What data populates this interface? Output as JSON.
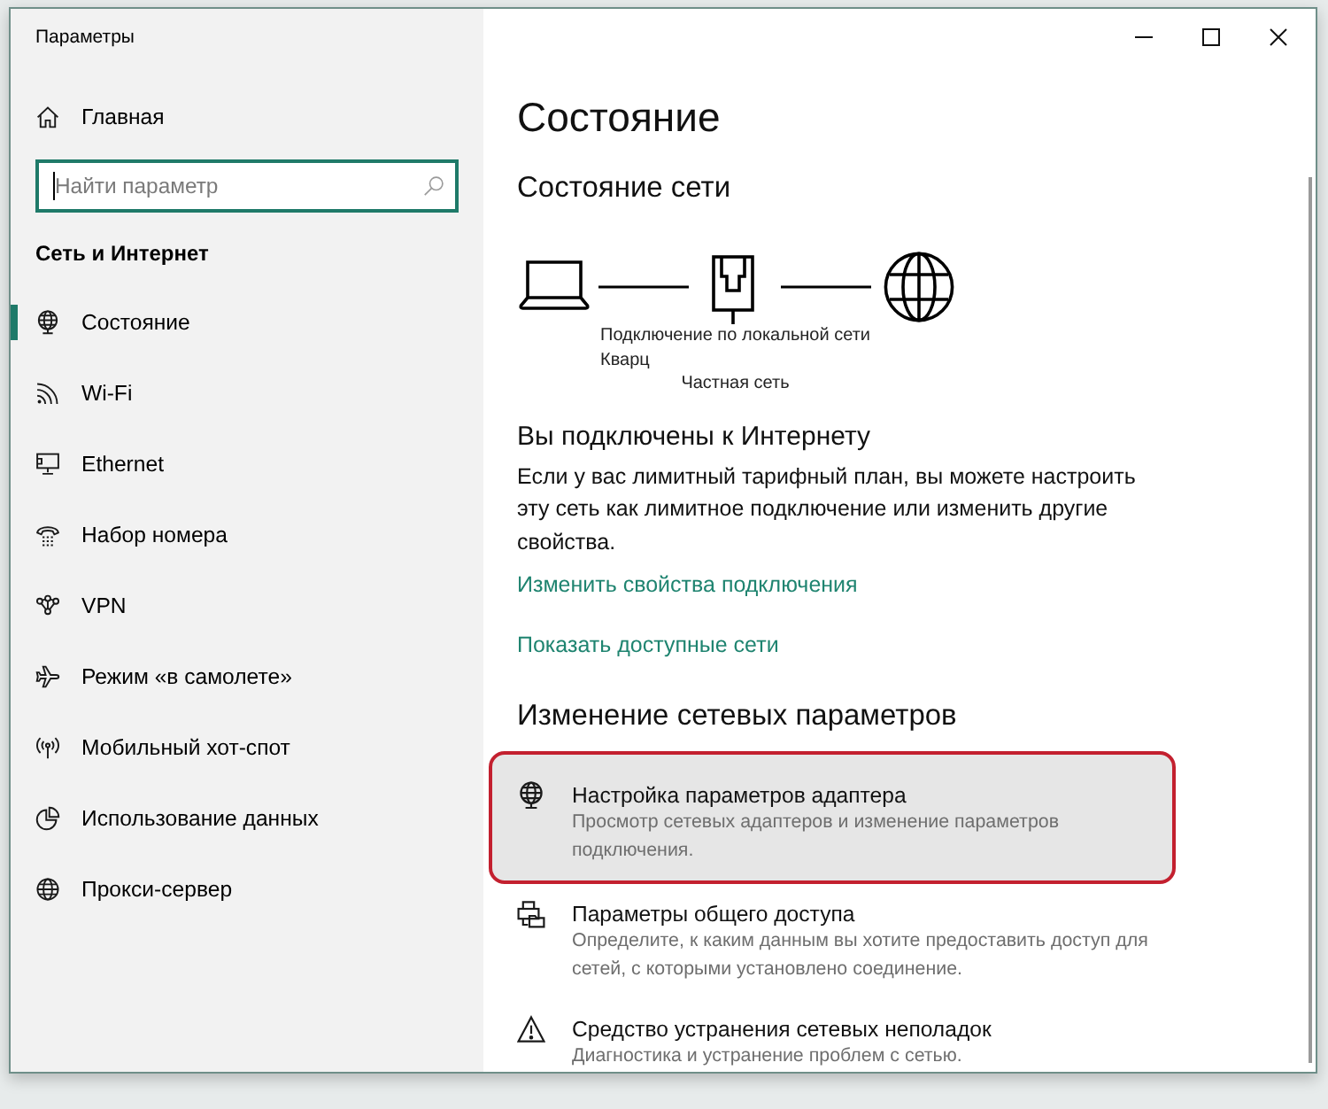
{
  "window": {
    "title": "Параметры"
  },
  "sidebar": {
    "home": {
      "label": "Главная"
    },
    "search": {
      "placeholder": "Найти параметр",
      "focused": true
    },
    "section_title": "Сеть и Интернет",
    "items": [
      {
        "label": "Состояние",
        "selected": true
      },
      {
        "label": "Wi-Fi",
        "selected": false
      },
      {
        "label": "Ethernet",
        "selected": false
      },
      {
        "label": "Набор номера",
        "selected": false
      },
      {
        "label": "VPN",
        "selected": false
      },
      {
        "label": "Режим «в самолете»",
        "selected": false
      },
      {
        "label": "Мобильный хот-спот",
        "selected": false
      },
      {
        "label": "Использование данных",
        "selected": false
      },
      {
        "label": "Прокси-сервер",
        "selected": false
      }
    ]
  },
  "content": {
    "title": "Состояние",
    "network_status": {
      "heading": "Состояние сети",
      "connection_name": "Подключение по локальной сети",
      "network_name": "Кварц",
      "network_profile": "Частная сеть"
    },
    "connection": {
      "heading": "Вы подключены к Интернету",
      "text": "Если у вас лимитный тарифный план, вы можете настроить эту сеть как лимитное подключение или изменить другие свойства.",
      "links": [
        "Изменить свойства подключения",
        "Показать доступные сети"
      ]
    },
    "change_settings": {
      "heading": "Изменение сетевых параметров",
      "options": [
        {
          "title": "Настройка параметров адаптера",
          "description": "Просмотр сетевых адаптеров и изменение параметров подключения.",
          "highlighted": true
        },
        {
          "title": "Параметры общего доступа",
          "description": "Определите, к каким данным вы хотите предоставить доступ для сетей, с которыми установлено соединение.",
          "highlighted": false
        },
        {
          "title": "Средство устранения сетевых неполадок",
          "description": "Диагностика и устранение проблем с сетью.",
          "highlighted": false
        }
      ]
    }
  }
}
